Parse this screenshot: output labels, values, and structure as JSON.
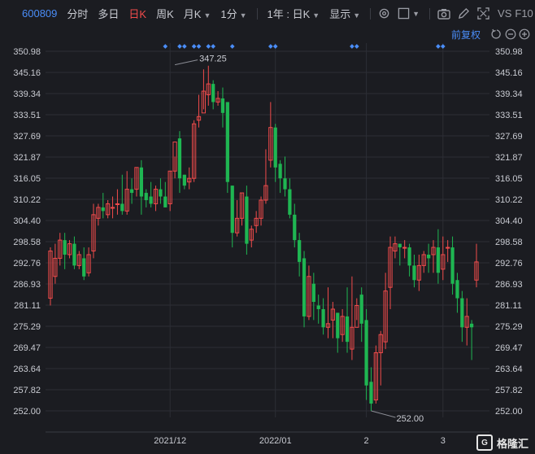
{
  "toolbar": {
    "code": "600809",
    "items": [
      "分时",
      "多日",
      "日K",
      "周K",
      "月K",
      "1分"
    ],
    "active_index": 2,
    "period": "1年 : 日K",
    "display": "显示",
    "vs": "VS",
    "f10": "F10"
  },
  "adjust_label": "前复权",
  "colors": {
    "up": "#f04b4b",
    "down": "#1fb652",
    "grid": "#2c2e35",
    "axis_text": "#c9cbd2",
    "accent": "#4a8df8",
    "background": "#1b1c21"
  },
  "brand": {
    "name": "格隆汇"
  },
  "chart_data": {
    "type": "candlestick",
    "y_ticks": [
      350.98,
      345.16,
      339.34,
      333.51,
      327.69,
      321.87,
      316.05,
      310.22,
      304.4,
      298.58,
      292.76,
      286.93,
      281.11,
      275.29,
      269.47,
      263.64,
      257.82,
      252.0
    ],
    "ylim": [
      252.0,
      350.98
    ],
    "x_labels": [
      {
        "label": "2021/12",
        "index": 25
      },
      {
        "label": "2022/01",
        "index": 47
      },
      {
        "label": "2",
        "index": 66
      },
      {
        "label": "3",
        "index": 82
      }
    ],
    "n_bars": 90,
    "annotations": [
      {
        "text": "347.25",
        "index": 26,
        "value": 347.25,
        "kind": "high"
      },
      {
        "text": "252.00",
        "index": 67,
        "value": 252.0,
        "kind": "low"
      }
    ],
    "markers": [
      24,
      27,
      28,
      30,
      31,
      33,
      34,
      38,
      46,
      47,
      63,
      64,
      81,
      82
    ],
    "candles": [
      [
        283,
        296,
        281,
        297
      ],
      [
        289,
        294,
        287,
        298
      ],
      [
        294,
        299,
        292,
        301
      ],
      [
        299,
        295,
        291,
        301
      ],
      [
        295,
        298,
        294,
        299
      ],
      [
        298,
        292,
        291,
        300
      ],
      [
        292,
        295,
        291,
        296
      ],
      [
        294,
        289,
        288,
        297
      ],
      [
        290,
        295,
        289,
        297
      ],
      [
        296,
        306,
        294,
        309
      ],
      [
        305,
        308,
        303,
        309
      ],
      [
        308,
        307,
        305,
        312
      ],
      [
        306,
        309,
        305,
        310
      ],
      [
        308,
        308,
        305,
        311
      ],
      [
        309,
        309,
        306,
        313
      ],
      [
        309,
        307,
        306,
        317
      ],
      [
        307,
        313,
        306,
        318
      ],
      [
        313,
        312,
        309,
        316
      ],
      [
        313,
        319,
        311,
        319
      ],
      [
        319,
        311,
        306,
        321
      ],
      [
        312,
        310,
        308,
        313
      ],
      [
        311,
        309,
        308,
        315
      ],
      [
        309,
        313,
        307,
        314
      ],
      [
        313,
        311,
        309,
        316
      ],
      [
        311,
        308,
        308,
        315
      ],
      [
        309,
        318,
        307,
        318
      ],
      [
        318,
        326,
        316,
        322
      ],
      [
        327,
        316,
        312,
        329
      ],
      [
        317,
        314,
        313,
        317
      ],
      [
        315,
        316,
        313,
        319
      ],
      [
        316,
        331,
        315,
        332
      ],
      [
        332,
        333,
        330,
        339
      ],
      [
        334,
        340,
        335,
        346
      ],
      [
        339,
        342,
        336,
        347
      ],
      [
        342,
        337,
        335,
        343
      ],
      [
        337,
        338,
        336,
        340
      ],
      [
        338,
        334,
        330,
        341
      ],
      [
        337,
        315,
        312,
        335
      ],
      [
        314,
        301,
        297,
        314
      ],
      [
        301,
        305,
        300,
        310
      ],
      [
        305,
        312,
        303,
        312
      ],
      [
        311,
        298,
        295,
        314
      ],
      [
        299,
        302,
        297,
        303
      ],
      [
        303,
        305,
        301,
        307
      ],
      [
        305,
        310,
        303,
        311
      ],
      [
        310,
        314,
        309,
        324
      ],
      [
        321,
        330,
        319,
        337
      ],
      [
        330,
        319,
        315,
        331
      ],
      [
        320,
        316,
        312,
        321
      ],
      [
        316,
        313,
        311,
        322
      ],
      [
        313,
        306,
        305,
        316
      ],
      [
        306,
        299,
        297,
        309
      ],
      [
        299,
        293,
        289,
        301
      ],
      [
        294,
        278,
        275,
        296
      ],
      [
        278,
        289,
        277,
        292
      ],
      [
        287,
        282,
        277,
        290
      ],
      [
        281,
        280,
        276,
        284
      ],
      [
        280,
        275,
        273,
        283
      ],
      [
        275,
        276,
        272,
        286
      ],
      [
        277,
        280,
        272,
        282
      ],
      [
        279,
        272,
        268,
        279
      ],
      [
        273,
        278,
        271,
        280
      ],
      [
        278,
        271,
        268,
        286
      ],
      [
        269,
        275,
        266,
        289
      ],
      [
        275,
        281,
        277,
        283
      ],
      [
        284,
        276,
        271,
        286
      ],
      [
        277,
        259,
        255,
        280
      ],
      [
        260,
        254,
        252,
        264
      ],
      [
        255,
        268,
        254,
        270
      ],
      [
        268,
        273,
        259,
        274
      ],
      [
        271,
        285,
        269,
        290
      ],
      [
        286,
        297,
        280,
        300
      ],
      [
        296,
        298,
        294,
        300
      ],
      [
        298,
        297,
        292,
        298
      ],
      [
        297,
        297,
        294,
        299
      ],
      [
        297,
        292,
        289,
        298
      ],
      [
        292,
        288,
        286,
        295
      ],
      [
        288,
        292,
        285,
        295
      ],
      [
        292,
        295,
        290,
        296
      ],
      [
        295,
        294,
        290,
        298
      ],
      [
        295,
        297,
        290,
        299
      ],
      [
        297,
        290,
        287,
        302
      ],
      [
        291,
        295,
        288,
        300
      ],
      [
        297,
        297,
        293,
        299
      ],
      [
        297,
        287,
        284,
        300
      ],
      [
        288,
        283,
        279,
        290
      ],
      [
        283,
        275,
        271,
        285
      ],
      [
        275,
        278,
        270,
        283
      ],
      [
        276,
        275,
        266,
        277
      ],
      [
        288,
        293,
        286,
        298
      ]
    ]
  }
}
